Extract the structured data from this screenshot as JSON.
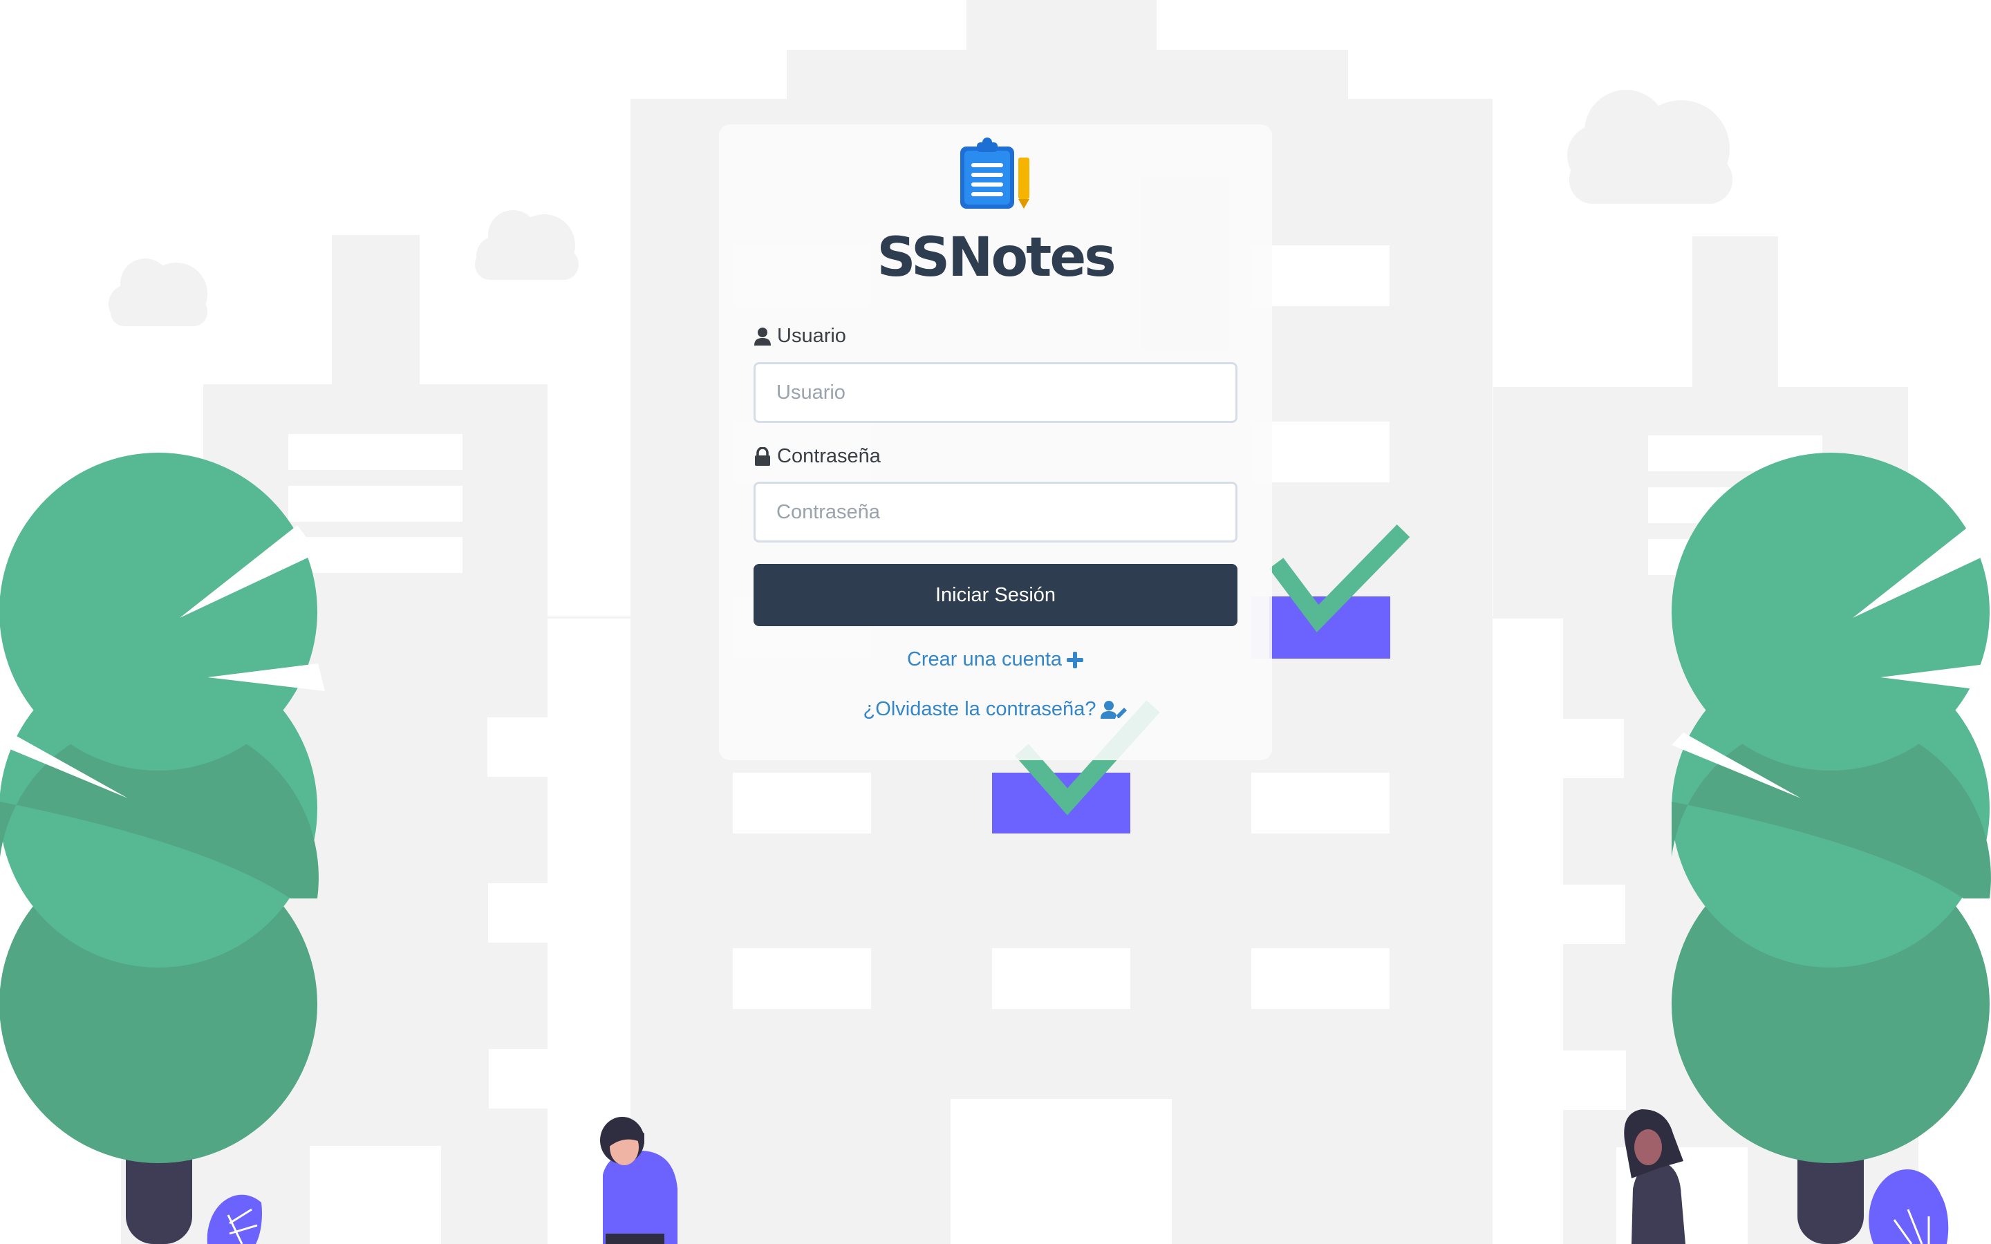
{
  "app": {
    "brand_name": "SSNotes",
    "logo_icon": "clipboard-pencil-icon"
  },
  "form": {
    "username": {
      "label": "Usuario",
      "placeholder": "Usuario",
      "icon": "user-icon"
    },
    "password": {
      "label": "Contraseña",
      "placeholder": "Contraseña",
      "icon": "lock-icon"
    },
    "submit_label": "Iniciar Sesión"
  },
  "links": {
    "create_account": "Crear una cuenta",
    "create_account_icon": "plus-icon",
    "forgot_password": "¿Olvidaste la contraseña?",
    "forgot_password_icon": "user-edit-icon"
  },
  "colors": {
    "primary": "#2e3e50",
    "link": "#3386c9",
    "tree_green": "#57b894",
    "accent_purple": "#6c63ff",
    "building_gray": "#f2f2f2"
  }
}
